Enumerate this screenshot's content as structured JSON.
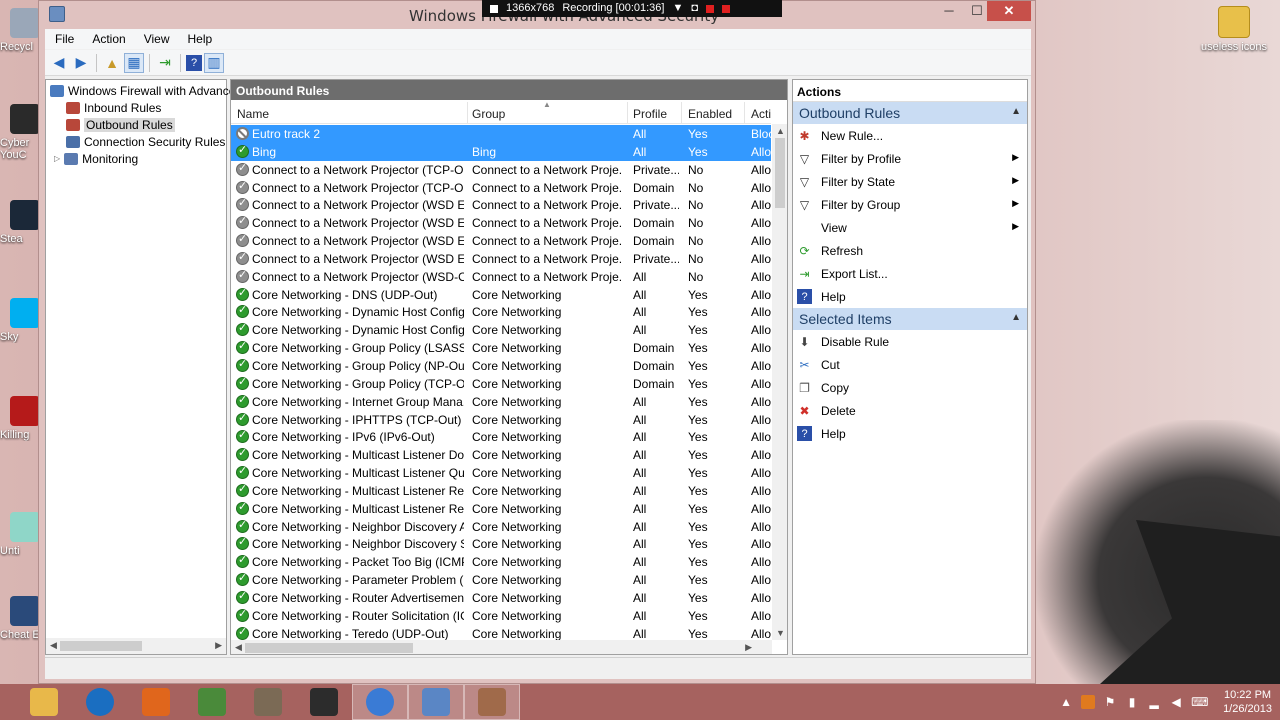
{
  "window": {
    "title": "Windows Firewall with Advanced Security",
    "minimize": "─",
    "maximize": "☐",
    "close": "✕"
  },
  "recording": {
    "resolution": "1366x768",
    "status": "Recording [00:01:36]"
  },
  "desktop": {
    "left_icons": [
      "Recycl",
      "Cyber YouC",
      "Stea",
      "Sky",
      "Killing",
      "Unti",
      "Cheat E"
    ],
    "right_icon": "useless icons"
  },
  "menu": [
    "File",
    "Action",
    "View",
    "Help"
  ],
  "tree": {
    "root": "Windows Firewall with Advance",
    "items": [
      "Inbound Rules",
      "Outbound Rules",
      "Connection Security Rules",
      "Monitoring"
    ]
  },
  "center": {
    "header": "Outbound Rules",
    "columns": {
      "name": "Name",
      "group": "Group",
      "profile": "Profile",
      "enabled": "Enabled",
      "action": "Acti"
    },
    "rows": [
      {
        "name": "Eutro track 2",
        "group": "",
        "profile": "All",
        "enabled": "Yes",
        "action": "Bloc",
        "status": "block",
        "selected": true
      },
      {
        "name": "Bing",
        "group": "Bing",
        "profile": "All",
        "enabled": "Yes",
        "action": "Allo",
        "status": "allow",
        "selected": true
      },
      {
        "name": "Connect to a Network Projector (TCP-Out)",
        "group": "Connect to a Network Proje...",
        "profile": "Private...",
        "enabled": "No",
        "action": "Allo",
        "status": "disabled"
      },
      {
        "name": "Connect to a Network Projector (TCP-Out)",
        "group": "Connect to a Network Proje...",
        "profile": "Domain",
        "enabled": "No",
        "action": "Allo",
        "status": "disabled"
      },
      {
        "name": "Connect to a Network Projector (WSD Ev...",
        "group": "Connect to a Network Proje...",
        "profile": "Private...",
        "enabled": "No",
        "action": "Allo",
        "status": "disabled"
      },
      {
        "name": "Connect to a Network Projector (WSD Ev...",
        "group": "Connect to a Network Proje...",
        "profile": "Domain",
        "enabled": "No",
        "action": "Allo",
        "status": "disabled"
      },
      {
        "name": "Connect to a Network Projector (WSD Ev...",
        "group": "Connect to a Network Proje...",
        "profile": "Domain",
        "enabled": "No",
        "action": "Allo",
        "status": "disabled"
      },
      {
        "name": "Connect to a Network Projector (WSD Ev...",
        "group": "Connect to a Network Proje...",
        "profile": "Private...",
        "enabled": "No",
        "action": "Allo",
        "status": "disabled"
      },
      {
        "name": "Connect to a Network Projector (WSD-O...",
        "group": "Connect to a Network Proje...",
        "profile": "All",
        "enabled": "No",
        "action": "Allo",
        "status": "disabled"
      },
      {
        "name": "Core Networking - DNS (UDP-Out)",
        "group": "Core Networking",
        "profile": "All",
        "enabled": "Yes",
        "action": "Allo",
        "status": "allow"
      },
      {
        "name": "Core Networking - Dynamic Host Config...",
        "group": "Core Networking",
        "profile": "All",
        "enabled": "Yes",
        "action": "Allo",
        "status": "allow"
      },
      {
        "name": "Core Networking - Dynamic Host Config...",
        "group": "Core Networking",
        "profile": "All",
        "enabled": "Yes",
        "action": "Allo",
        "status": "allow"
      },
      {
        "name": "Core Networking - Group Policy (LSASS-...",
        "group": "Core Networking",
        "profile": "Domain",
        "enabled": "Yes",
        "action": "Allo",
        "status": "allow"
      },
      {
        "name": "Core Networking - Group Policy (NP-Out)",
        "group": "Core Networking",
        "profile": "Domain",
        "enabled": "Yes",
        "action": "Allo",
        "status": "allow"
      },
      {
        "name": "Core Networking - Group Policy (TCP-O...",
        "group": "Core Networking",
        "profile": "Domain",
        "enabled": "Yes",
        "action": "Allo",
        "status": "allow"
      },
      {
        "name": "Core Networking - Internet Group Mana...",
        "group": "Core Networking",
        "profile": "All",
        "enabled": "Yes",
        "action": "Allo",
        "status": "allow"
      },
      {
        "name": "Core Networking - IPHTTPS (TCP-Out)",
        "group": "Core Networking",
        "profile": "All",
        "enabled": "Yes",
        "action": "Allo",
        "status": "allow"
      },
      {
        "name": "Core Networking - IPv6 (IPv6-Out)",
        "group": "Core Networking",
        "profile": "All",
        "enabled": "Yes",
        "action": "Allo",
        "status": "allow"
      },
      {
        "name": "Core Networking - Multicast Listener Do...",
        "group": "Core Networking",
        "profile": "All",
        "enabled": "Yes",
        "action": "Allo",
        "status": "allow"
      },
      {
        "name": "Core Networking - Multicast Listener Qu...",
        "group": "Core Networking",
        "profile": "All",
        "enabled": "Yes",
        "action": "Allo",
        "status": "allow"
      },
      {
        "name": "Core Networking - Multicast Listener Rep...",
        "group": "Core Networking",
        "profile": "All",
        "enabled": "Yes",
        "action": "Allo",
        "status": "allow"
      },
      {
        "name": "Core Networking - Multicast Listener Rep...",
        "group": "Core Networking",
        "profile": "All",
        "enabled": "Yes",
        "action": "Allo",
        "status": "allow"
      },
      {
        "name": "Core Networking - Neighbor Discovery A...",
        "group": "Core Networking",
        "profile": "All",
        "enabled": "Yes",
        "action": "Allo",
        "status": "allow"
      },
      {
        "name": "Core Networking - Neighbor Discovery S...",
        "group": "Core Networking",
        "profile": "All",
        "enabled": "Yes",
        "action": "Allo",
        "status": "allow"
      },
      {
        "name": "Core Networking - Packet Too Big (ICMP...",
        "group": "Core Networking",
        "profile": "All",
        "enabled": "Yes",
        "action": "Allo",
        "status": "allow"
      },
      {
        "name": "Core Networking - Parameter Problem (I...",
        "group": "Core Networking",
        "profile": "All",
        "enabled": "Yes",
        "action": "Allo",
        "status": "allow"
      },
      {
        "name": "Core Networking - Router Advertisement...",
        "group": "Core Networking",
        "profile": "All",
        "enabled": "Yes",
        "action": "Allo",
        "status": "allow"
      },
      {
        "name": "Core Networking - Router Solicitation (IC...",
        "group": "Core Networking",
        "profile": "All",
        "enabled": "Yes",
        "action": "Allo",
        "status": "allow"
      },
      {
        "name": "Core Networking - Teredo (UDP-Out)",
        "group": "Core Networking",
        "profile": "All",
        "enabled": "Yes",
        "action": "Allo",
        "status": "allow"
      }
    ]
  },
  "actions": {
    "title": "Actions",
    "sections": [
      {
        "title": "Outbound Rules",
        "items": [
          {
            "label": "New Rule...",
            "icon": "new-rule-icon",
            "glyph": "✱",
            "color": "#c0392b",
            "submenu": false
          },
          {
            "label": "Filter by Profile",
            "icon": "filter-icon",
            "glyph": "▽",
            "color": "#333333",
            "submenu": true
          },
          {
            "label": "Filter by State",
            "icon": "filter-icon",
            "glyph": "▽",
            "color": "#333333",
            "submenu": true
          },
          {
            "label": "Filter by Group",
            "icon": "filter-icon",
            "glyph": "▽",
            "color": "#333333",
            "submenu": true
          },
          {
            "label": "View",
            "icon": "view-icon",
            "glyph": "",
            "color": "#333333",
            "submenu": true
          },
          {
            "label": "Refresh",
            "icon": "refresh-icon",
            "glyph": "⟳",
            "color": "#2e9b2e",
            "submenu": false
          },
          {
            "label": "Export List...",
            "icon": "export-icon",
            "glyph": "⇥",
            "color": "#2e9b2e",
            "submenu": false
          },
          {
            "label": "Help",
            "icon": "help-icon",
            "glyph": "?",
            "color": "#2a4fa8",
            "submenu": false
          }
        ]
      },
      {
        "title": "Selected Items",
        "items": [
          {
            "label": "Disable Rule",
            "icon": "disable-rule-icon",
            "glyph": "⬇",
            "color": "#444444",
            "submenu": false
          },
          {
            "label": "Cut",
            "icon": "cut-icon",
            "glyph": "✂",
            "color": "#2a6bbf",
            "submenu": false
          },
          {
            "label": "Copy",
            "icon": "copy-icon",
            "glyph": "❐",
            "color": "#555555",
            "submenu": false
          },
          {
            "label": "Delete",
            "icon": "delete-icon",
            "glyph": "✖",
            "color": "#d0302a",
            "submenu": false
          },
          {
            "label": "Help",
            "icon": "help-icon",
            "glyph": "?",
            "color": "#2a4fa8",
            "submenu": false
          }
        ]
      }
    ]
  },
  "taskbar": {
    "apps": [
      {
        "icon": "file-explorer-icon",
        "color": "#e8b84a"
      },
      {
        "icon": "hp-icon",
        "color": "#1a6ec1"
      },
      {
        "icon": "firefox-icon",
        "color": "#e0661c"
      },
      {
        "icon": "app-icon",
        "color": "#4a8a3a"
      },
      {
        "icon": "gimp-icon",
        "color": "#7b6a55"
      },
      {
        "icon": "app-icon",
        "color": "#2c2c2c"
      },
      {
        "icon": "itunes-icon",
        "color": "#3a7bd5"
      },
      {
        "icon": "control-panel-icon",
        "color": "#5a86c5"
      },
      {
        "icon": "firewall-icon",
        "color": "#a06a4a"
      }
    ],
    "time": "10:22 PM",
    "date": "1/26/2013"
  }
}
